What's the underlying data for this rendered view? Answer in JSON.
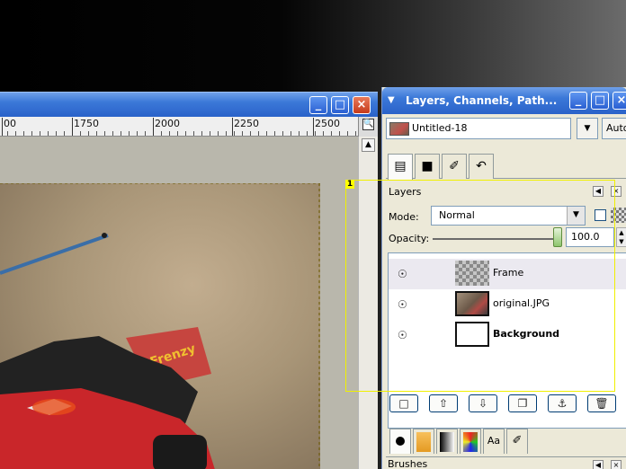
{
  "image_window": {
    "ruler_ticks": [
      "00",
      "1750",
      "2000",
      "2250",
      "2500"
    ],
    "buttons": {
      "minimize": "_",
      "maximize": "□",
      "close": "×"
    }
  },
  "dock": {
    "title": "Layers, Channels, Path...",
    "image_selector": {
      "value": "Untitled-18",
      "auto_label": "Auto"
    },
    "tabs": [
      "layers-tab",
      "channels-tab",
      "paths-tab",
      "undo-history-tab"
    ],
    "layers": {
      "panel_title": "Layers",
      "mode_label": "Mode:",
      "mode_value": "Normal",
      "opacity_label": "Opacity:",
      "opacity_value": "100.0",
      "opacity_fraction": 1.0,
      "items": [
        {
          "name": "Frame",
          "thumbnail": "checker",
          "visible": true,
          "bold": false
        },
        {
          "name": "original.JPG",
          "thumbnail": "photo",
          "visible": true,
          "bold": false
        },
        {
          "name": "Background",
          "thumbnail": "white",
          "visible": true,
          "bold": true
        }
      ],
      "buttons": [
        "new-layer",
        "raise-layer",
        "lower-layer",
        "duplicate-layer",
        "anchor-layer",
        "delete-layer"
      ]
    },
    "bottom_tabs": [
      "brush-tab",
      "pattern-tab",
      "gradient-tab",
      "palette-tab",
      "font-tab",
      "document-tab"
    ],
    "brushes_label": "Brushes"
  },
  "annotation": {
    "label": "1",
    "color": "#ffff00"
  }
}
